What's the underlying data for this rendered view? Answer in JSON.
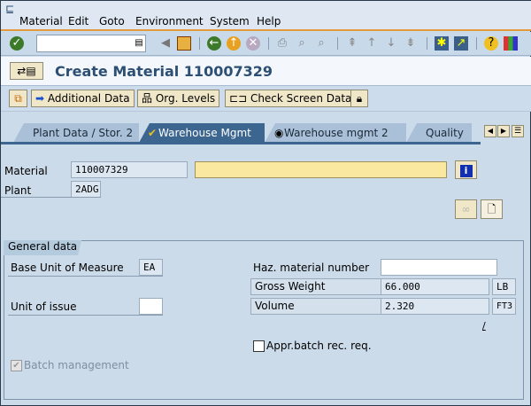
{
  "menu": [
    "Material",
    "Edit",
    "Goto",
    "Environment",
    "System",
    "Help"
  ],
  "toolbar": {
    "command_value": "",
    "icons": [
      "enter-icon",
      "save-icon",
      "back-icon",
      "exit-icon",
      "cancel-icon",
      "print-icon",
      "find-icon",
      "find-next-icon",
      "first-page-icon",
      "prev-page-icon",
      "next-page-icon",
      "last-page-icon",
      "new-session-icon",
      "shortcut-icon",
      "help-icon",
      "layout-icon"
    ]
  },
  "title": "Create Material 110007329",
  "app_toolbar": {
    "additional_data": "Additional Data",
    "org_levels": "Org. Levels",
    "check_screen_data": "Check Screen Data"
  },
  "tabs": [
    {
      "label": "Plant Data / Stor. 2",
      "active": false
    },
    {
      "label": "Warehouse Mgmt",
      "active": true
    },
    {
      "label": "Warehouse mgmt 2",
      "active": false
    },
    {
      "label": "Quality ...",
      "active": false
    }
  ],
  "header": {
    "material_label": "Material",
    "material_value": "110007329",
    "description_value": "",
    "plant_label": "Plant",
    "plant_value": "2ADG"
  },
  "general": {
    "title": "General data",
    "base_uom_label": "Base Unit of Measure",
    "base_uom_value": "EA",
    "unit_issue_label": "Unit of issue",
    "unit_issue_value": "",
    "haz_label": "Haz. material number",
    "haz_value": "",
    "gross_label": "Gross Weight",
    "gross_value": "66.000",
    "gross_unit": "LB",
    "volume_label": "Volume",
    "volume_value": "2.320",
    "volume_unit": "FT3",
    "slash": "/",
    "appr_label": "Appr.batch rec. req.",
    "appr_checked": false,
    "batch_label": "Batch management",
    "batch_checked": true
  },
  "colors": {
    "title": "#2c4f73",
    "active_tab": "#3c6690",
    "required_field": "#fbe8a0"
  }
}
